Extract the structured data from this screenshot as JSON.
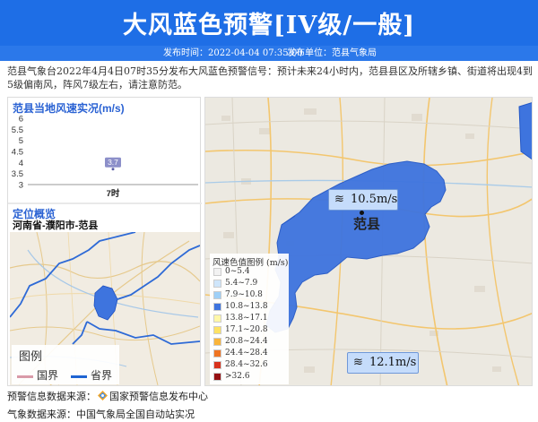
{
  "header": {
    "title": "大风蓝色预警[IV级/一般]",
    "publish_time": "发布时间：2022-04-04 07:35:00",
    "publish_unit": "发布单位：范县气象局"
  },
  "description": "范县气象台2022年4月4日07时35分发布大风蓝色预警信号：预计未来24小时内，范县县区及所辖乡镇、街道将出现4到5级偏南风，阵风7级左右，请注意防范。",
  "wind_panel": {
    "title": "范县当地风速实况(m/s)"
  },
  "chart_data": {
    "type": "bar",
    "categories": [
      "7时"
    ],
    "values": [
      3.7
    ],
    "title": "范县当地风速实况(m/s)",
    "ylim": [
      3,
      6
    ],
    "yticks": [
      "3",
      "3.5",
      "4",
      "4.5",
      "5",
      "5.5",
      "6"
    ],
    "data_labels": [
      "3.7"
    ],
    "colors": {
      "label_bg": "#8c8fc9"
    }
  },
  "location": {
    "title": "定位概览",
    "path": "河南省-濮阳市-范县",
    "legend": {
      "title": "图例",
      "items": [
        {
          "label": "国界",
          "color": "#d99aa8"
        },
        {
          "label": "省界",
          "color": "#1e64d2"
        }
      ]
    }
  },
  "main_map": {
    "wind_readings": [
      "10.5m/s",
      "12.1m/s"
    ],
    "city_name": "范县",
    "legend_title": "风速色值图例 (m/s)",
    "legend_items": [
      {
        "label": "0~5.4",
        "color": "#f2f2f2"
      },
      {
        "label": "5.4~7.9",
        "color": "#cfe6fb"
      },
      {
        "label": "7.9~10.8",
        "color": "#9fd0f7"
      },
      {
        "label": "10.8~13.8",
        "color": "#3e74de"
      },
      {
        "label": "13.8~17.1",
        "color": "#fff7a8"
      },
      {
        "label": "17.1~20.8",
        "color": "#fde264"
      },
      {
        "label": "20.8~24.4",
        "color": "#f9b43a"
      },
      {
        "label": "24.4~28.4",
        "color": "#ef7423"
      },
      {
        "label": "28.4~32.6",
        "color": "#d8321c"
      },
      {
        "label": ">32.6",
        "color": "#951013"
      }
    ]
  },
  "footer": {
    "warning_source": "预警信息数据来源：",
    "warning_source_name": "国家预警信息发布中心",
    "met_source": "气象数据来源：中国气象局全国自动站实况"
  },
  "colors": {
    "header_bg": "#1e6ee6",
    "accent": "#2a62d3",
    "warning_area": "#3e74de"
  }
}
